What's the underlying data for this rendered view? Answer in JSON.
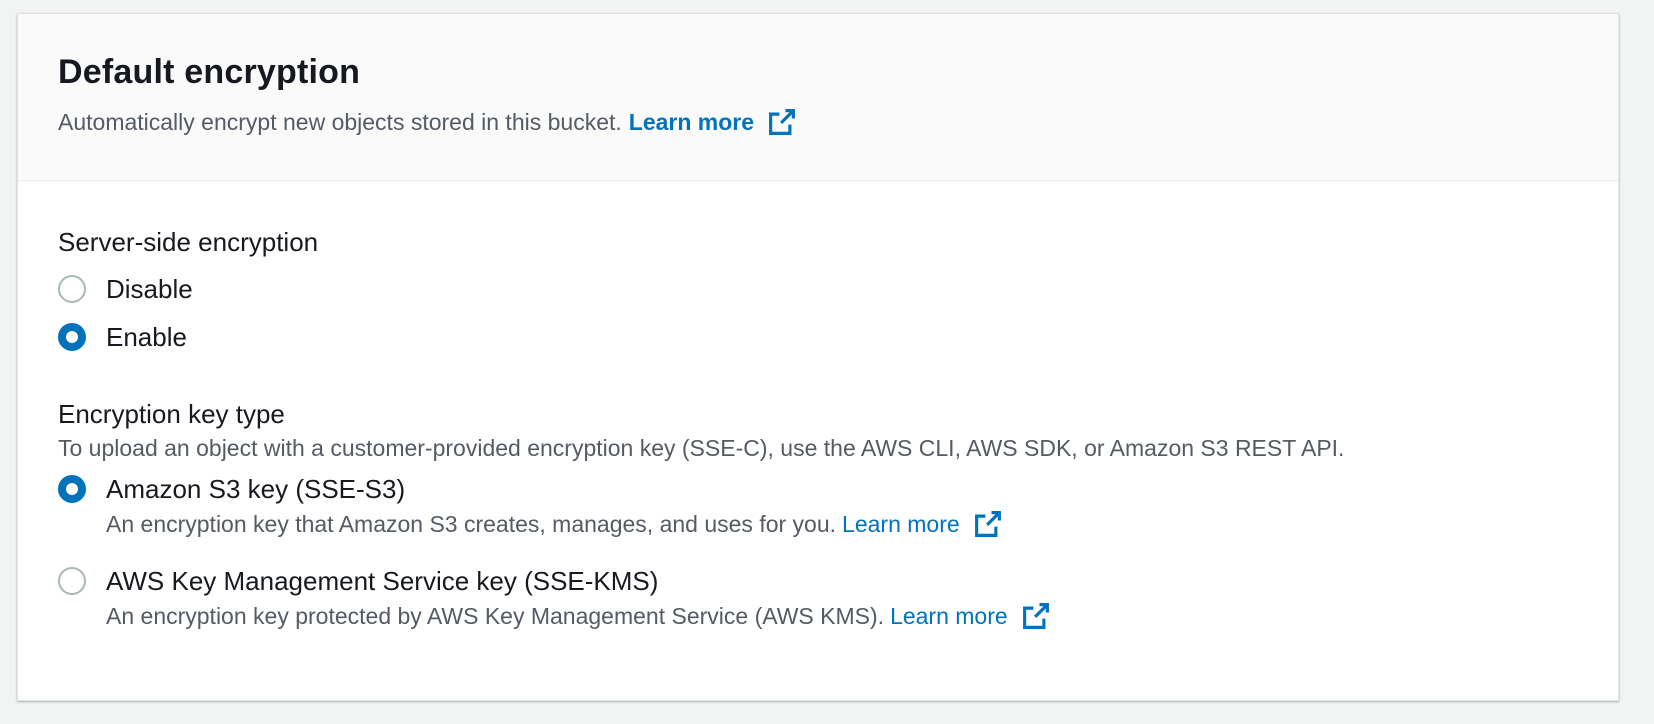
{
  "header": {
    "title": "Default encryption",
    "description": "Automatically encrypt new objects stored in this bucket.",
    "learn_more": "Learn more",
    "external_icon": "external-link-icon"
  },
  "server_side_encryption": {
    "label": "Server-side encryption",
    "options": [
      {
        "label": "Disable",
        "checked": false
      },
      {
        "label": "Enable",
        "checked": true
      }
    ]
  },
  "key_type": {
    "label": "Encryption key type",
    "hint": "To upload an object with a customer-provided encryption key (SSE-C), use the AWS CLI, AWS SDK, or Amazon S3 REST API.",
    "options": [
      {
        "label": "Amazon S3 key (SSE-S3)",
        "description": "An encryption key that Amazon S3 creates, manages, and uses for you.",
        "learn_more": "Learn more",
        "checked": true
      },
      {
        "label": "AWS Key Management Service key (SSE-KMS)",
        "description": "An encryption key protected by AWS Key Management Service (AWS KMS).",
        "learn_more": "Learn more",
        "checked": false
      }
    ]
  },
  "colors": {
    "accent": "#0073bb",
    "text": "#16191f",
    "secondary_text": "#545b64",
    "radio_border": "#aab7b8"
  }
}
